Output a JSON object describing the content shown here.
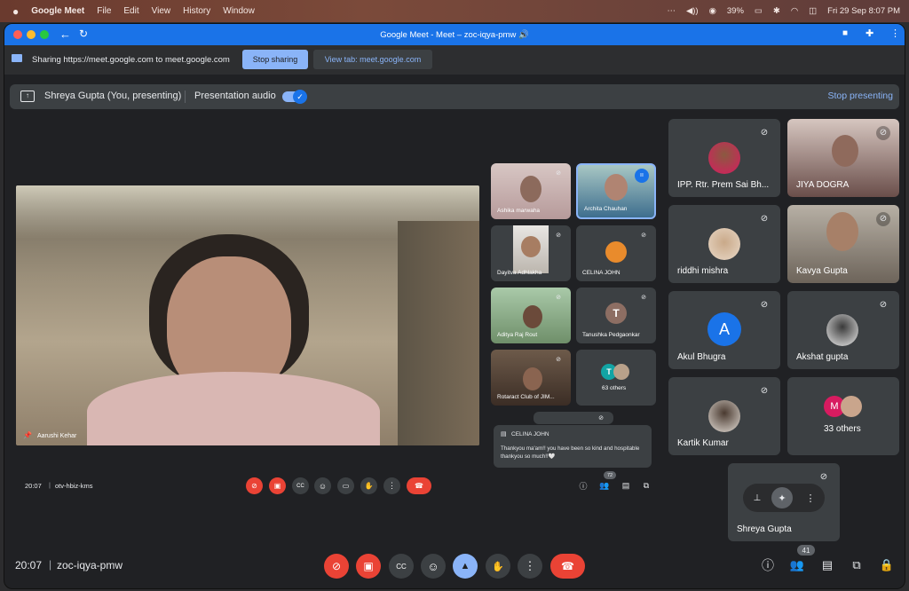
{
  "menubar": {
    "app": "Google Meet",
    "items": [
      "File",
      "Edit",
      "View",
      "History",
      "Window"
    ],
    "battery": "39%",
    "datetime": "Fri 29 Sep  8:07 PM"
  },
  "window": {
    "title": "Google Meet - Meet – zoc-iqya-pmw 🔊"
  },
  "sharing": {
    "message": "Sharing https://meet.google.com to meet.google.com",
    "stop_label": "Stop sharing",
    "view_tab_label": "View tab: meet.google.com"
  },
  "presenting": {
    "presenter": "Shreya Gupta (You, presenting)",
    "audio_label": "Presentation audio",
    "stop_label": "Stop presenting"
  },
  "shared_screen": {
    "main_speaker": "Aarushi Kehar",
    "thumbs": [
      {
        "name": "Ashika marwaha"
      },
      {
        "name": "Archita Chauhan"
      },
      {
        "name": "Dayitva Adhlakha"
      },
      {
        "name": "CELINA JOHN"
      },
      {
        "name": "Aditya Raj Rout"
      },
      {
        "name": "Tanushka Pedgaonkar",
        "initial": "T"
      },
      {
        "name": "Rotaract Club of JIM..."
      },
      {
        "name": "63 others",
        "initial": "T"
      }
    ],
    "chat": {
      "sender": "CELINA JOHN",
      "message": "Thankyou ma'am!! you have been so kind and hospitable thankyou so much!!🤍"
    },
    "time": "20:07",
    "code": "otv-hbiz-kms",
    "people_badge": "72"
  },
  "participants": [
    {
      "name": "IPP. Rtr. Prem Sai Bh..."
    },
    {
      "name": "JIYA DOGRA"
    },
    {
      "name": "riddhi mishra"
    },
    {
      "name": "Kavya Gupta"
    },
    {
      "name": "Akul Bhugra",
      "initial": "A"
    },
    {
      "name": "Akshat gupta"
    },
    {
      "name": "Kartik Kumar"
    },
    {
      "name": "33 others",
      "initial": "M"
    },
    {
      "name": "Shreya Gupta"
    }
  ],
  "bottom": {
    "time": "20:07",
    "separator": "|",
    "code": "zoc-iqya-pmw",
    "people_badge": "41"
  },
  "colors": {
    "accent": "#1a73e8",
    "hangup": "#ea4335",
    "avatar_blue": "#1a73e8",
    "avatar_brown": "#8d6e63",
    "avatar_pink": "#d81b60",
    "avatar_teal": "#12a4a4"
  }
}
